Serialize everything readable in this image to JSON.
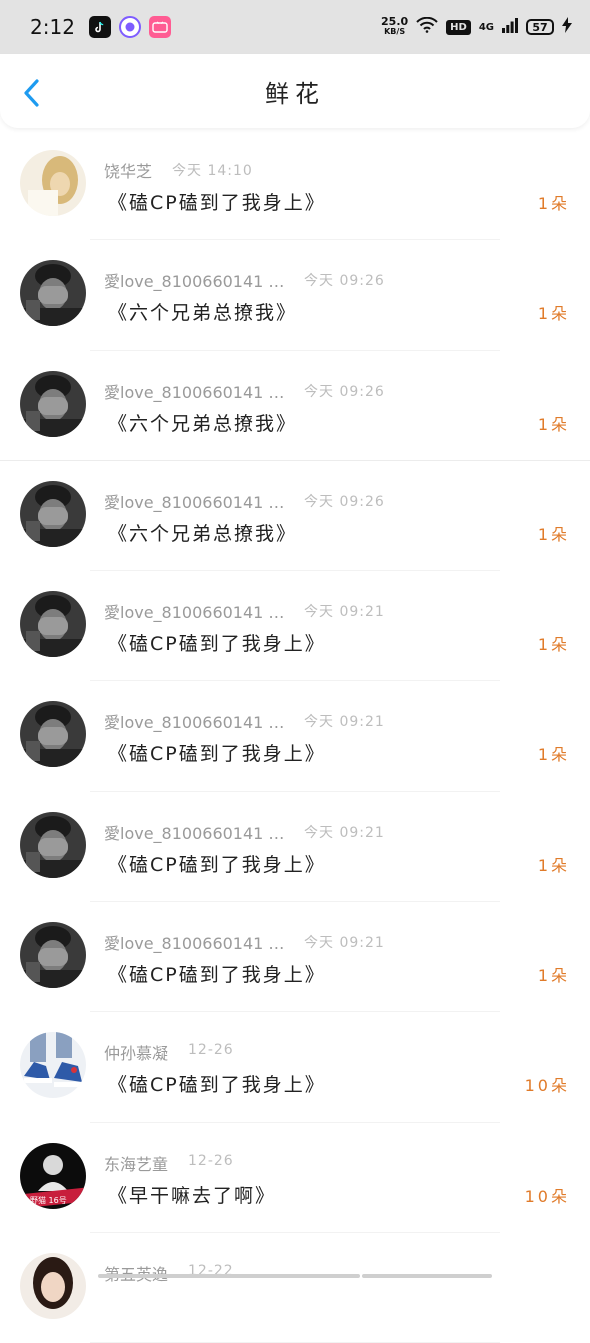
{
  "status_bar": {
    "time": "2:12",
    "net_speed": "25.0",
    "net_unit": "KB/S",
    "hd": "HD",
    "network": "4G",
    "battery": "57",
    "notif_icons": [
      "tiktok-icon",
      "circle-app-icon",
      "bilibili-icon"
    ]
  },
  "header": {
    "title": "鲜花",
    "back_icon": "chevron-left-icon",
    "accent": "#1e9bf0"
  },
  "rows": [
    {
      "name": "饶华芝",
      "time": "今天 14:10",
      "book": "《磕CP磕到了我身上》",
      "count": "1朵",
      "avatar": "blonde-girl"
    },
    {
      "name": "愛love_8100660141 …",
      "time": "今天 09:26",
      "book": "《六个兄弟总撩我》",
      "count": "1朵",
      "avatar": "face-cover"
    },
    {
      "name": "愛love_8100660141 …",
      "time": "今天 09:26",
      "book": "《六个兄弟总撩我》",
      "count": "1朵",
      "avatar": "face-cover"
    },
    {
      "name": "愛love_8100660141 …",
      "time": "今天 09:26",
      "book": "《六个兄弟总撩我》",
      "count": "1朵",
      "avatar": "face-cover"
    },
    {
      "name": "愛love_8100660141 …",
      "time": "今天 09:21",
      "book": "《磕CP磕到了我身上》",
      "count": "1朵",
      "avatar": "face-cover"
    },
    {
      "name": "愛love_8100660141 …",
      "time": "今天 09:21",
      "book": "《磕CP磕到了我身上》",
      "count": "1朵",
      "avatar": "face-cover"
    },
    {
      "name": "愛love_8100660141 …",
      "time": "今天 09:21",
      "book": "《磕CP磕到了我身上》",
      "count": "1朵",
      "avatar": "face-cover"
    },
    {
      "name": "愛love_8100660141 …",
      "time": "今天 09:21",
      "book": "《磕CP磕到了我身上》",
      "count": "1朵",
      "avatar": "face-cover"
    },
    {
      "name": "仲孙慕凝",
      "time": "12-26",
      "book": "《磕CP磕到了我身上》",
      "count": "10朵",
      "avatar": "sneakers"
    },
    {
      "name": "东海艺童",
      "time": "12-26",
      "book": "《早干嘛去了啊》",
      "count": "10朵",
      "avatar": "dark-portrait"
    },
    {
      "name": "第五英逸",
      "time": "12-22",
      "book": "",
      "count": "",
      "avatar": "girl-portrait"
    }
  ],
  "colors": {
    "count": "#e07b2a",
    "name": "#9a9a9a",
    "time": "#bdbdbd",
    "status_bg": "#e3e3e3"
  }
}
